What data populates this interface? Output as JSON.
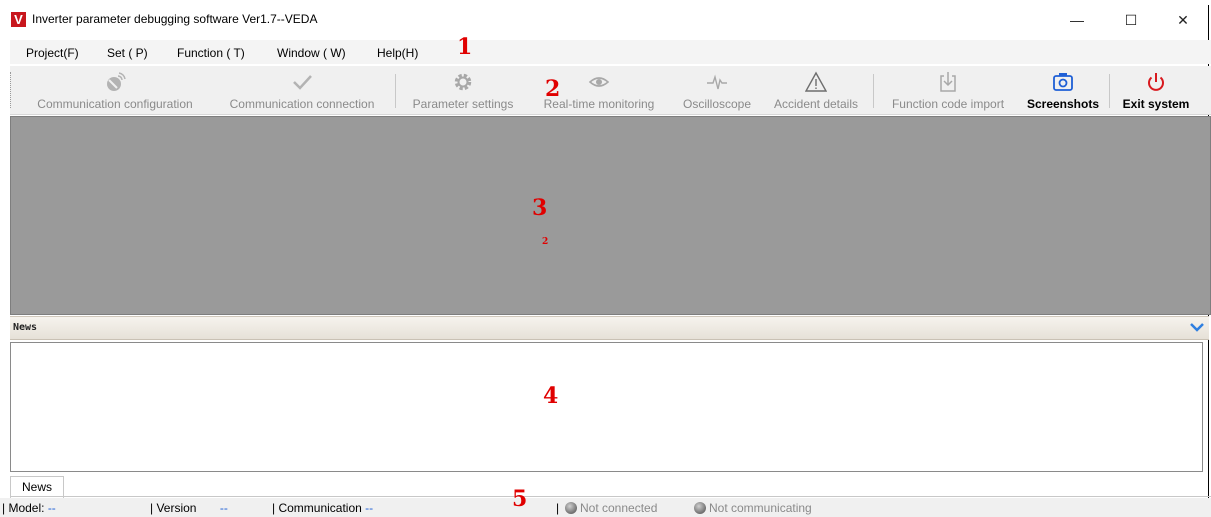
{
  "window": {
    "logo_letter": "V",
    "title": "Inverter parameter debugging software Ver1.7--VEDA",
    "minimize": "—",
    "maximize": "☐",
    "close": "✕"
  },
  "menu": [
    {
      "label": "Project(F)"
    },
    {
      "label": "Set ( P)"
    },
    {
      "label": "Function ( T)"
    },
    {
      "label": "Window ( W)"
    },
    {
      "label": "Help(H)"
    }
  ],
  "toolbar": [
    {
      "label": "Communication configuration",
      "icon": "satellite-dish-icon",
      "enabled": false
    },
    {
      "label": "Communication connection",
      "icon": "checkmark-icon",
      "enabled": false
    },
    {
      "label": "Parameter settings",
      "icon": "gear-icon",
      "enabled": false
    },
    {
      "label": "Real-time monitoring",
      "icon": "eye-icon",
      "enabled": false
    },
    {
      "label": "Oscilloscope",
      "icon": "waveform-icon",
      "enabled": false
    },
    {
      "label": "Accident details",
      "icon": "warning-triangle-icon",
      "enabled": false
    },
    {
      "label": "Function code import",
      "icon": "import-icon",
      "enabled": false
    },
    {
      "label": "Screenshots",
      "icon": "camera-icon",
      "enabled": true
    },
    {
      "label": "Exit system",
      "icon": "power-icon",
      "enabled": true
    }
  ],
  "news_panel": {
    "header": "News",
    "tab_label": "News"
  },
  "status": {
    "model_label": "| Model:",
    "model_value": "--",
    "version_label": "| Version",
    "version_value": "--",
    "comm_label": "| Communication",
    "comm_value": "--",
    "separator": "|",
    "connection": "Not connected",
    "communicating": "Not communicating"
  },
  "annotations": [
    "1",
    "2",
    "3",
    "2",
    "4",
    "5"
  ],
  "colors": {
    "accent_blue": "#1e5fd6",
    "exit_red": "#d8191e",
    "logo_red": "#c8161d",
    "annotation_red": "#e00000",
    "workspace_gray": "#9a9a9a"
  }
}
